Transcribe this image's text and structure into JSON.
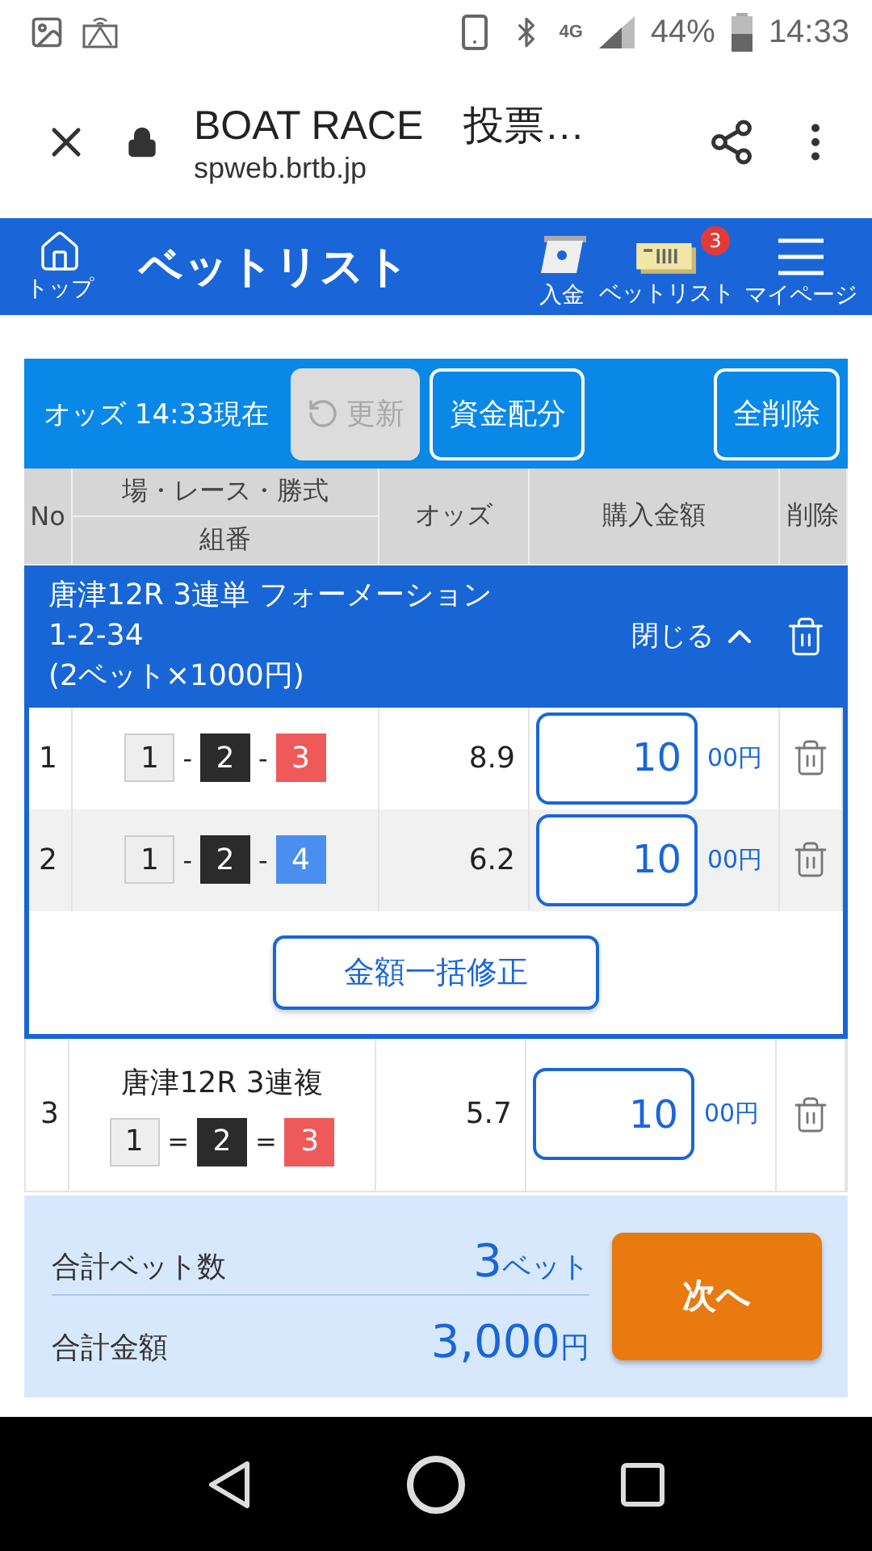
{
  "status_bar": {
    "network": "4G",
    "battery": "44%",
    "time": "14:33"
  },
  "browser": {
    "title": "BOAT RACE　投票…",
    "url": "spweb.brtb.jp"
  },
  "header": {
    "home": "トップ",
    "title": "ベットリスト",
    "actions": [
      {
        "kind": "deposit",
        "label": "入金"
      },
      {
        "kind": "ticket",
        "label": "ベットリスト",
        "badge": "3"
      },
      {
        "kind": "menu",
        "label": "マイページ"
      }
    ]
  },
  "toolbar": {
    "odds_time": "オッズ 14:33現在",
    "buttons": [
      {
        "kind": "refresh",
        "label": "更新",
        "disabled": true
      },
      {
        "kind": "plain",
        "label": "資金配分",
        "disabled": false
      },
      {
        "kind": "plain",
        "label": "全削除",
        "disabled": false
      }
    ]
  },
  "table": {
    "columns": [
      "No",
      "場・レース・勝式",
      "組番",
      "オッズ",
      "購入金額",
      "削除"
    ],
    "entries": [
      {
        "kind": "group",
        "title": "唐津12R 3連単 フォーメーション",
        "combo": "1-2-34",
        "detail": "(2ベット×1000円)",
        "toggle": "閉じる",
        "expanded": true,
        "bulk_button": "金額一括修正",
        "rows": [
          {
            "no": "1",
            "numbers": [
              {
                "label": "1",
                "color": "#eeeeee"
              },
              {
                "label": "2",
                "color": "#2b2b2b"
              },
              {
                "label": "3",
                "color": "#ee5a5a"
              }
            ],
            "separators": [
              "-",
              "-"
            ],
            "odds": "8.9",
            "amount": "10",
            "unit": "00円"
          },
          {
            "no": "2",
            "numbers": [
              {
                "label": "1",
                "color": "#eeeeee"
              },
              {
                "label": "2",
                "color": "#2b2b2b"
              },
              {
                "label": "4",
                "color": "#4a8ff0"
              }
            ],
            "separators": [
              "-",
              "-"
            ],
            "odds": "6.2",
            "amount": "10",
            "unit": "00円"
          }
        ]
      },
      {
        "kind": "single",
        "no": "3",
        "title": "唐津12R 3連複",
        "numbers": [
          {
            "label": "1",
            "color": "#eeeeee"
          },
          {
            "label": "2",
            "color": "#2b2b2b"
          },
          {
            "label": "3",
            "color": "#ee5a5a"
          }
        ],
        "separators": [
          "=",
          "="
        ],
        "odds": "5.7",
        "amount": "10",
        "unit": "00円"
      }
    ]
  },
  "summary": {
    "rows": [
      {
        "label": "合計ベット数",
        "value": "3",
        "unit": "ベット"
      },
      {
        "label": "合計金額",
        "value": "3,000",
        "unit": "円"
      }
    ],
    "next_button": "次へ"
  }
}
